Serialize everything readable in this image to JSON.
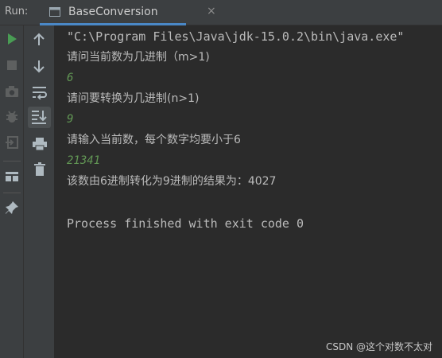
{
  "header": {
    "run_label": "Run:",
    "tab_label": "BaseConversion",
    "tab_close": "×"
  },
  "toolbar_left": {
    "icons": [
      "run-icon",
      "stop-icon",
      "screenshot-icon",
      "debug-icon",
      "exit-icon",
      "layout-icon",
      "pin-icon"
    ]
  },
  "toolbar_right": {
    "icons": [
      "up-arrow-icon",
      "down-arrow-icon",
      "soft-wrap-icon",
      "scroll-to-end-icon",
      "print-icon",
      "trash-icon"
    ]
  },
  "console": {
    "lines": [
      "\"C:\\Program Files\\Java\\jdk-15.0.2\\bin\\java.exe\"",
      "请问当前数为几进制（m>1)",
      "6",
      "请问要转换为几进制(n>1)",
      "9",
      "请输入当前数，每个数字均要小于6",
      "21341",
      "该数由6进制转化为9进制的结果为：4027",
      "Process finished with exit code 0"
    ]
  },
  "watermark": "CSDN @这个对数不太对",
  "colors": {
    "background": "#2b2b2b",
    "panel": "#3c3f41",
    "text": "#bbbbbb",
    "input_text": "#629755",
    "run_green": "#499c54",
    "accent_blue": "#4a88c7"
  }
}
